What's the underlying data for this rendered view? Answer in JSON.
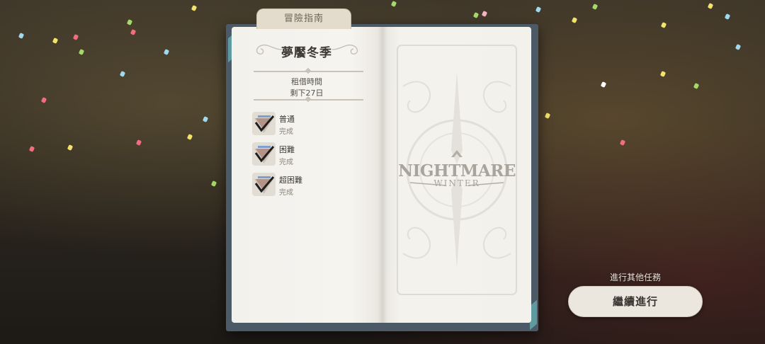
{
  "tab_title": "冒險指南",
  "season_title": "夢饜冬季",
  "rental": {
    "label": "租借時間",
    "remaining": "剩下27日"
  },
  "quests": [
    {
      "name": "普通",
      "status": "完成"
    },
    {
      "name": "困難",
      "status": "完成"
    },
    {
      "name": "超困難",
      "status": "完成"
    }
  ],
  "logo": {
    "line1": "NIGHTMARE",
    "line2": "WINTER"
  },
  "next_hint": "進行其他任務",
  "continue_label": "繼續進行",
  "colors": {
    "book_cover": "#4b5a66",
    "page": "#f3f1ec",
    "accent": "#5e9aa0"
  }
}
